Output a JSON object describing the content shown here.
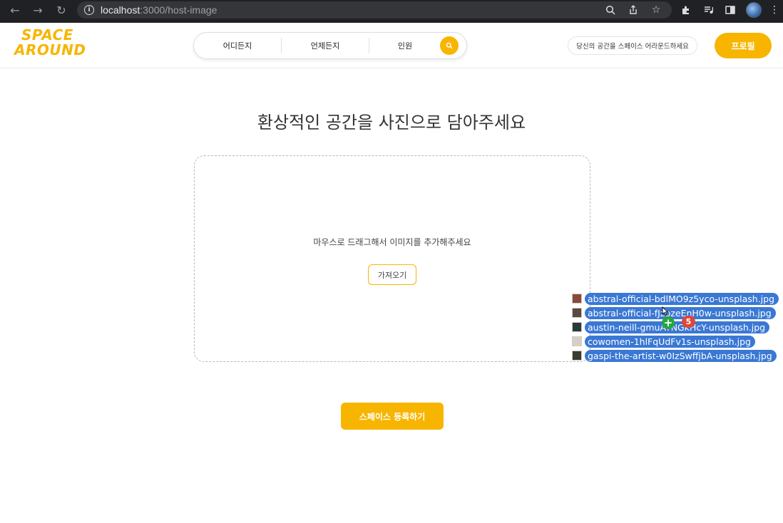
{
  "browser": {
    "url_host": "localhost",
    "url_rest": ":3000/host-image"
  },
  "header": {
    "logo_line1": "SPACE",
    "logo_line2": "AROUND",
    "search": {
      "where": "어디든지",
      "when": "언제든지",
      "guests": "인원"
    },
    "tagline": "당신의 공간을 스페이스 어라운드하세요",
    "profile_label": "프로필"
  },
  "main": {
    "heading": "환상적인 공간을 사진으로 담아주세요",
    "drop_text": "마우스로 드래그해서 이미지를 추가해주세요",
    "import_label": "가져오기",
    "submit_label": "스페이스 등록하기"
  },
  "drag": {
    "files": [
      "abstral-official-bdlMO9z5yco-unsplash.jpg",
      "abstral-official-fJzbzeEnH0w-unsplash.jpg",
      "austin-neill-gmuAYNGkHcY-unsplash.jpg",
      "cowomen-1hlFqUdFv1s-unsplash.jpg",
      "gaspi-the-artist-w0IzSwffjbA-unsplash.jpg"
    ],
    "plus": "+",
    "count": "5"
  },
  "colors": {
    "accent": "#f7b500",
    "drag_highlight": "#3a78d4"
  }
}
